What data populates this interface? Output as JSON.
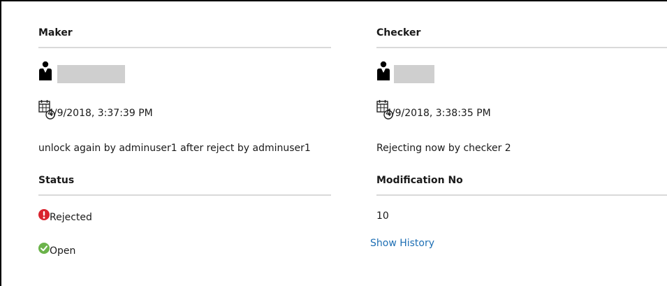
{
  "maker": {
    "heading": "Maker",
    "user_icon": "person-icon",
    "date_icon": "calendar-clock-icon",
    "timestamp": "4/9/2018, 3:37:39 PM",
    "comment": "unlock again by adminuser1 after reject by adminuser1"
  },
  "checker": {
    "heading": "Checker",
    "user_icon": "person-icon",
    "date_icon": "calendar-clock-icon",
    "timestamp": "4/9/2018, 3:38:35 PM",
    "comment": "Rejecting now by checker 2"
  },
  "status": {
    "heading": "Status",
    "items": [
      {
        "label": "Rejected",
        "icon": "exclamation-circle-icon",
        "color": "#d9232e"
      },
      {
        "label": "Open",
        "icon": "checkmark-circle-icon",
        "color": "#6bb34a"
      }
    ]
  },
  "modification": {
    "heading": "Modification No",
    "value": "10",
    "history_link": "Show History",
    "link_color": "#1e6fb4"
  },
  "colors": {
    "divider": "#d9d9d9",
    "redaction": "#cfcfcf"
  }
}
